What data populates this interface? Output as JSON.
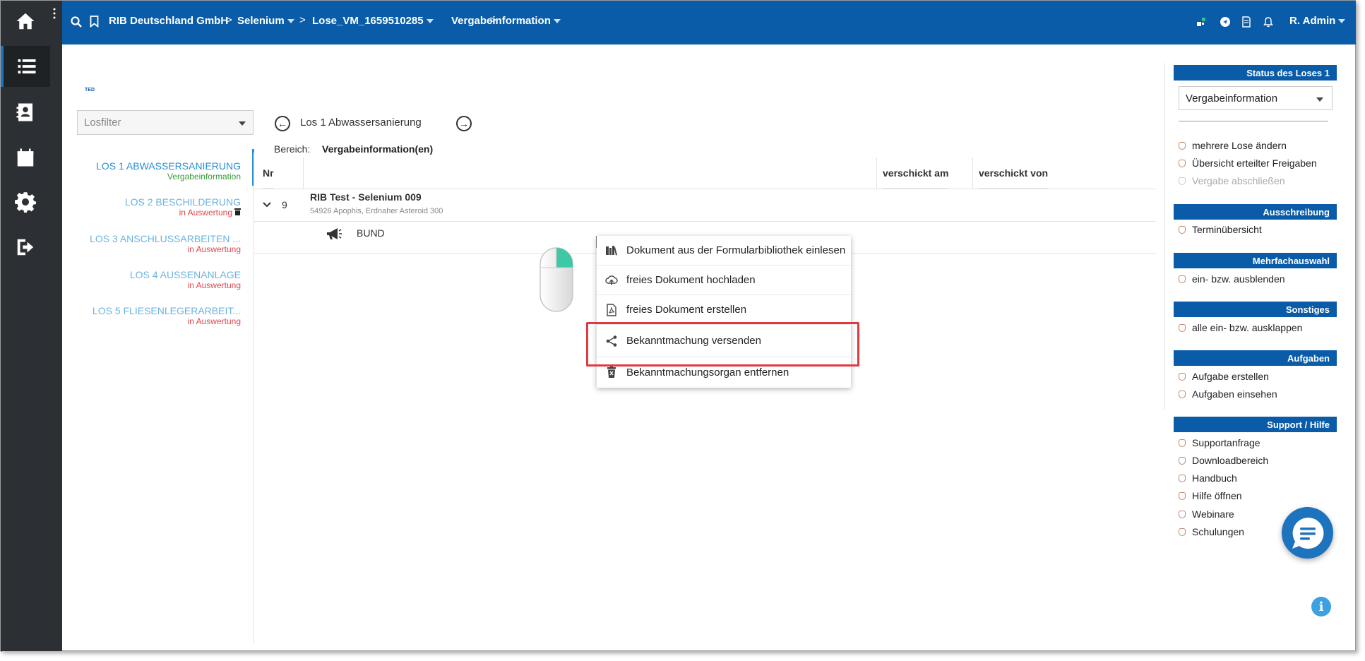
{
  "topbar": {
    "breadcrumbs": [
      {
        "label": "RIB Deutschland GmbH",
        "has_caret": false
      },
      {
        "label": "Selenium",
        "has_caret": true
      },
      {
        "label": "Lose_VM_1659510285",
        "has_caret": true
      },
      {
        "label": "Vergabeinformation",
        "has_caret": true
      }
    ],
    "separator": ">",
    "user": "R. Admin"
  },
  "sidebar": {
    "items": [
      "home-icon",
      "list-icon",
      "contacts-icon",
      "calendar-icon",
      "gear-icon",
      "logout-icon"
    ],
    "active_index": 1
  },
  "logo_text": "TED",
  "losfilter": {
    "placeholder": "Losfilter"
  },
  "lots": [
    {
      "name": "LOS 1 ABWASSERSANIERUNG",
      "status": "Vergabeinformation",
      "active": true
    },
    {
      "name": "LOS 2 BESCHILDERUNG",
      "status": "in Auswertung",
      "active": false
    },
    {
      "name": "LOS 3 ANSCHLUSSARBEITEN ...",
      "status": "in Auswertung",
      "active": false
    },
    {
      "name": "LOS 4 AUSSENANLAGE",
      "status": "in Auswertung",
      "active": false
    },
    {
      "name": "LOS 5 FLIESENLEGERARBEIT...",
      "status": "in Auswertung",
      "active": false
    }
  ],
  "main": {
    "lot_title": "Los 1 Abwassersanierung",
    "bereich_label": "Bereich:",
    "bereich_value": "Vergabeinformation(en)",
    "table": {
      "headers": {
        "nr": "Nr",
        "sent_at": "verschickt am",
        "sent_by": "verschickt von"
      },
      "row": {
        "nr": "9",
        "company": "RIB Test - Selenium 009",
        "address": "54926 Apophis, Erdnaher Asteroid 300",
        "subrow_label": "BUND"
      }
    }
  },
  "context_menu": {
    "items": [
      {
        "label": "Dokument aus der Formularbibliothek einlesen",
        "icon": "library-icon"
      },
      {
        "label": "freies Dokument hochladen",
        "icon": "cloud-upload-icon"
      },
      {
        "label": "freies Dokument erstellen",
        "icon": "pdf-document-icon"
      },
      {
        "label": "Bekanntmachung versenden",
        "icon": "share-icon"
      },
      {
        "label": "Bekanntmachungsorgan entfernen",
        "icon": "trash-icon"
      }
    ],
    "highlighted_index": 3
  },
  "right_panel": {
    "sections": [
      {
        "title": "Status des Loses 1",
        "items": []
      },
      {
        "title": "Ausschreibung",
        "items": [
          "Terminübersicht"
        ]
      },
      {
        "title": "Mehrfachauswahl",
        "items": [
          "ein- bzw. ausblenden"
        ]
      },
      {
        "title": "Sonstiges",
        "items": [
          "alle ein- bzw. ausklappen"
        ]
      },
      {
        "title": "Aufgaben",
        "items": [
          "Aufgabe erstellen",
          "Aufgaben einsehen"
        ]
      },
      {
        "title": "Support / Hilfe",
        "items": [
          "Supportanfrage",
          "Downloadbereich",
          "Handbuch",
          "Hilfe öffnen",
          "Webinare",
          "Schulungen"
        ]
      }
    ],
    "status_select": "Vergabeinformation",
    "status_items": [
      {
        "label": "mehrere Lose ändern",
        "disabled": false
      },
      {
        "label": "Übersicht erteilter Freigaben",
        "disabled": false
      },
      {
        "label": "Vergabe abschließen",
        "disabled": true
      }
    ]
  },
  "colors": {
    "primary": "#0a5ca8",
    "sidebar": "#2c2f33",
    "highlight": "#e0393e",
    "status_red": "#e0474c",
    "status_green": "#3a9a3a"
  }
}
